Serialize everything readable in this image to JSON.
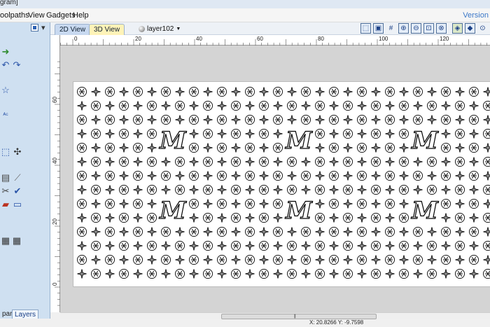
{
  "window": {
    "title_fragment": "gram]"
  },
  "menu": {
    "items": [
      "oolpaths",
      "View",
      "Gadgets",
      "Help"
    ],
    "version_link": "Version"
  },
  "left_panel": {
    "tabs": [
      "part",
      "Layers"
    ],
    "tool_icons": [
      "green-arrow-icon",
      "undo-icon",
      "redo-icon",
      "star-icon",
      "text-icon",
      "transform-icon",
      "node-edit-icon",
      "select-icon",
      "weld-icon",
      "trim-icon",
      "check-icon",
      "layers-icon",
      "blend-icon",
      "grid-icon",
      "group-icon"
    ]
  },
  "view_tabs": {
    "tab_2d": "2D View",
    "tab_3d": "3D View"
  },
  "layer_selector": {
    "value": "layer102"
  },
  "view_buttons": [
    "view-zoom-box-icon",
    "view-fit-icon",
    "grid-toggle-icon",
    "zoom-in-icon",
    "zoom-out-icon",
    "zoom-extents-icon",
    "zoom-drawing-icon",
    "snap-icon",
    "preview-icon"
  ],
  "rulers": {
    "horizontal_labels": [
      "0",
      "20",
      "40",
      "60",
      "80",
      "100",
      "120"
    ],
    "vertical_labels": [
      "60",
      "40",
      "20",
      "0"
    ]
  },
  "canvas": {
    "pattern_glyph": "M",
    "sheet_color": "#ffffff",
    "canvas_bg": "#d4d4d4"
  },
  "status": {
    "coordinates": "X: 20.8266 Y: -9.7598"
  }
}
